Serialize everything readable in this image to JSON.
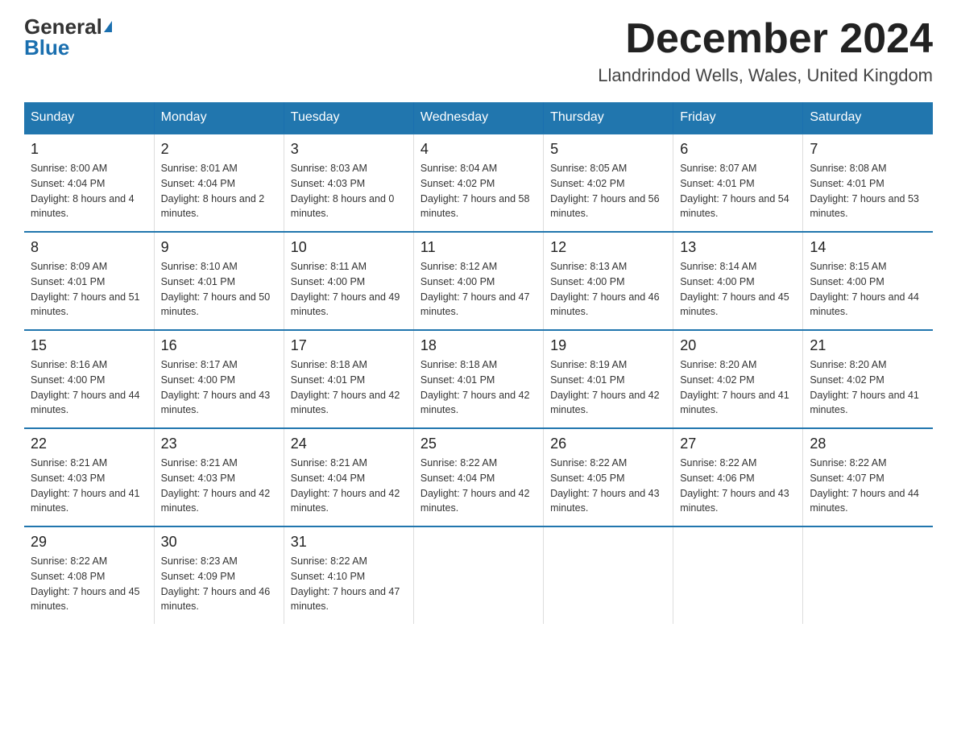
{
  "logo": {
    "general": "General",
    "blue": "Blue"
  },
  "title": "December 2024",
  "location": "Llandrindod Wells, Wales, United Kingdom",
  "days_of_week": [
    "Sunday",
    "Monday",
    "Tuesday",
    "Wednesday",
    "Thursday",
    "Friday",
    "Saturday"
  ],
  "weeks": [
    [
      {
        "day": "1",
        "sunrise": "8:00 AM",
        "sunset": "4:04 PM",
        "daylight": "8 hours and 4 minutes."
      },
      {
        "day": "2",
        "sunrise": "8:01 AM",
        "sunset": "4:04 PM",
        "daylight": "8 hours and 2 minutes."
      },
      {
        "day": "3",
        "sunrise": "8:03 AM",
        "sunset": "4:03 PM",
        "daylight": "8 hours and 0 minutes."
      },
      {
        "day": "4",
        "sunrise": "8:04 AM",
        "sunset": "4:02 PM",
        "daylight": "7 hours and 58 minutes."
      },
      {
        "day": "5",
        "sunrise": "8:05 AM",
        "sunset": "4:02 PM",
        "daylight": "7 hours and 56 minutes."
      },
      {
        "day": "6",
        "sunrise": "8:07 AM",
        "sunset": "4:01 PM",
        "daylight": "7 hours and 54 minutes."
      },
      {
        "day": "7",
        "sunrise": "8:08 AM",
        "sunset": "4:01 PM",
        "daylight": "7 hours and 53 minutes."
      }
    ],
    [
      {
        "day": "8",
        "sunrise": "8:09 AM",
        "sunset": "4:01 PM",
        "daylight": "7 hours and 51 minutes."
      },
      {
        "day": "9",
        "sunrise": "8:10 AM",
        "sunset": "4:01 PM",
        "daylight": "7 hours and 50 minutes."
      },
      {
        "day": "10",
        "sunrise": "8:11 AM",
        "sunset": "4:00 PM",
        "daylight": "7 hours and 49 minutes."
      },
      {
        "day": "11",
        "sunrise": "8:12 AM",
        "sunset": "4:00 PM",
        "daylight": "7 hours and 47 minutes."
      },
      {
        "day": "12",
        "sunrise": "8:13 AM",
        "sunset": "4:00 PM",
        "daylight": "7 hours and 46 minutes."
      },
      {
        "day": "13",
        "sunrise": "8:14 AM",
        "sunset": "4:00 PM",
        "daylight": "7 hours and 45 minutes."
      },
      {
        "day": "14",
        "sunrise": "8:15 AM",
        "sunset": "4:00 PM",
        "daylight": "7 hours and 44 minutes."
      }
    ],
    [
      {
        "day": "15",
        "sunrise": "8:16 AM",
        "sunset": "4:00 PM",
        "daylight": "7 hours and 44 minutes."
      },
      {
        "day": "16",
        "sunrise": "8:17 AM",
        "sunset": "4:00 PM",
        "daylight": "7 hours and 43 minutes."
      },
      {
        "day": "17",
        "sunrise": "8:18 AM",
        "sunset": "4:01 PM",
        "daylight": "7 hours and 42 minutes."
      },
      {
        "day": "18",
        "sunrise": "8:18 AM",
        "sunset": "4:01 PM",
        "daylight": "7 hours and 42 minutes."
      },
      {
        "day": "19",
        "sunrise": "8:19 AM",
        "sunset": "4:01 PM",
        "daylight": "7 hours and 42 minutes."
      },
      {
        "day": "20",
        "sunrise": "8:20 AM",
        "sunset": "4:02 PM",
        "daylight": "7 hours and 41 minutes."
      },
      {
        "day": "21",
        "sunrise": "8:20 AM",
        "sunset": "4:02 PM",
        "daylight": "7 hours and 41 minutes."
      }
    ],
    [
      {
        "day": "22",
        "sunrise": "8:21 AM",
        "sunset": "4:03 PM",
        "daylight": "7 hours and 41 minutes."
      },
      {
        "day": "23",
        "sunrise": "8:21 AM",
        "sunset": "4:03 PM",
        "daylight": "7 hours and 42 minutes."
      },
      {
        "day": "24",
        "sunrise": "8:21 AM",
        "sunset": "4:04 PM",
        "daylight": "7 hours and 42 minutes."
      },
      {
        "day": "25",
        "sunrise": "8:22 AM",
        "sunset": "4:04 PM",
        "daylight": "7 hours and 42 minutes."
      },
      {
        "day": "26",
        "sunrise": "8:22 AM",
        "sunset": "4:05 PM",
        "daylight": "7 hours and 43 minutes."
      },
      {
        "day": "27",
        "sunrise": "8:22 AM",
        "sunset": "4:06 PM",
        "daylight": "7 hours and 43 minutes."
      },
      {
        "day": "28",
        "sunrise": "8:22 AM",
        "sunset": "4:07 PM",
        "daylight": "7 hours and 44 minutes."
      }
    ],
    [
      {
        "day": "29",
        "sunrise": "8:22 AM",
        "sunset": "4:08 PM",
        "daylight": "7 hours and 45 minutes."
      },
      {
        "day": "30",
        "sunrise": "8:23 AM",
        "sunset": "4:09 PM",
        "daylight": "7 hours and 46 minutes."
      },
      {
        "day": "31",
        "sunrise": "8:22 AM",
        "sunset": "4:10 PM",
        "daylight": "7 hours and 47 minutes."
      },
      null,
      null,
      null,
      null
    ]
  ],
  "labels": {
    "sunrise": "Sunrise:",
    "sunset": "Sunset:",
    "daylight": "Daylight:"
  }
}
